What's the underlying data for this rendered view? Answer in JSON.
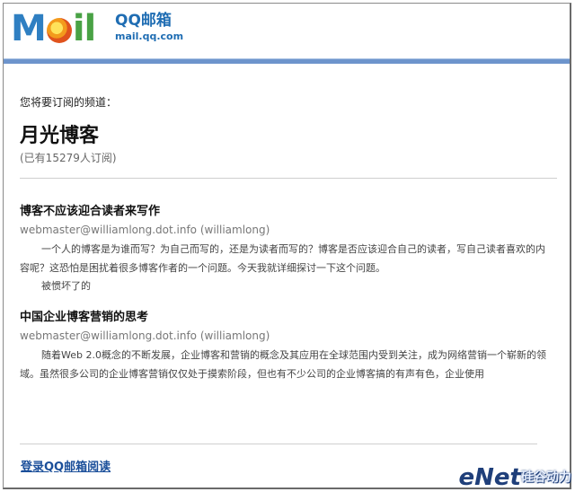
{
  "header": {
    "logo_left": "M",
    "logo_right": "il",
    "brand_name": "QQ邮箱",
    "brand_domain": "mail.qq.com"
  },
  "subscribe": {
    "prompt": "您将要订阅的频道：",
    "channel_name": "月光博客",
    "subscriber_count": "(已有15279人订阅)"
  },
  "articles": [
    {
      "title": "博客不应该迎合读者来写作",
      "author": "webmaster@williamlong.dot.info (williamlong)",
      "body": "一个人的博客是为谁而写？为自己而写的，还是为读者而写的？博客是否应该迎合自己的读者，写自己读者喜欢的内容呢？这恐怕是困扰着很多博客作者的一个问题。今天我就详细探讨一下这个问题。",
      "extra": "被惯坏了的"
    },
    {
      "title": "中国企业博客营销的思考",
      "author": "webmaster@williamlong.dot.info (williamlong)",
      "body": "随着Web 2.0概念的不断发展，企业博客和营销的概念及其应用在全球范围内受到关注，成为网络营销一个崭新的领域。虽然很多公司的企业博客营销仅仅处于摸索阶段，但也有不少公司的企业博客搞的有声有色，企业使用"
    }
  ],
  "footer": {
    "login_link": "登录QQ邮箱阅读"
  },
  "watermark": {
    "text": "eNet",
    "text_cn": "硅谷动力"
  },
  "colors": {
    "accent_bar": "#6d94cc",
    "brand_blue": "#1f6db3",
    "logo_green": "#49a245",
    "link": "#1b4f9a"
  }
}
